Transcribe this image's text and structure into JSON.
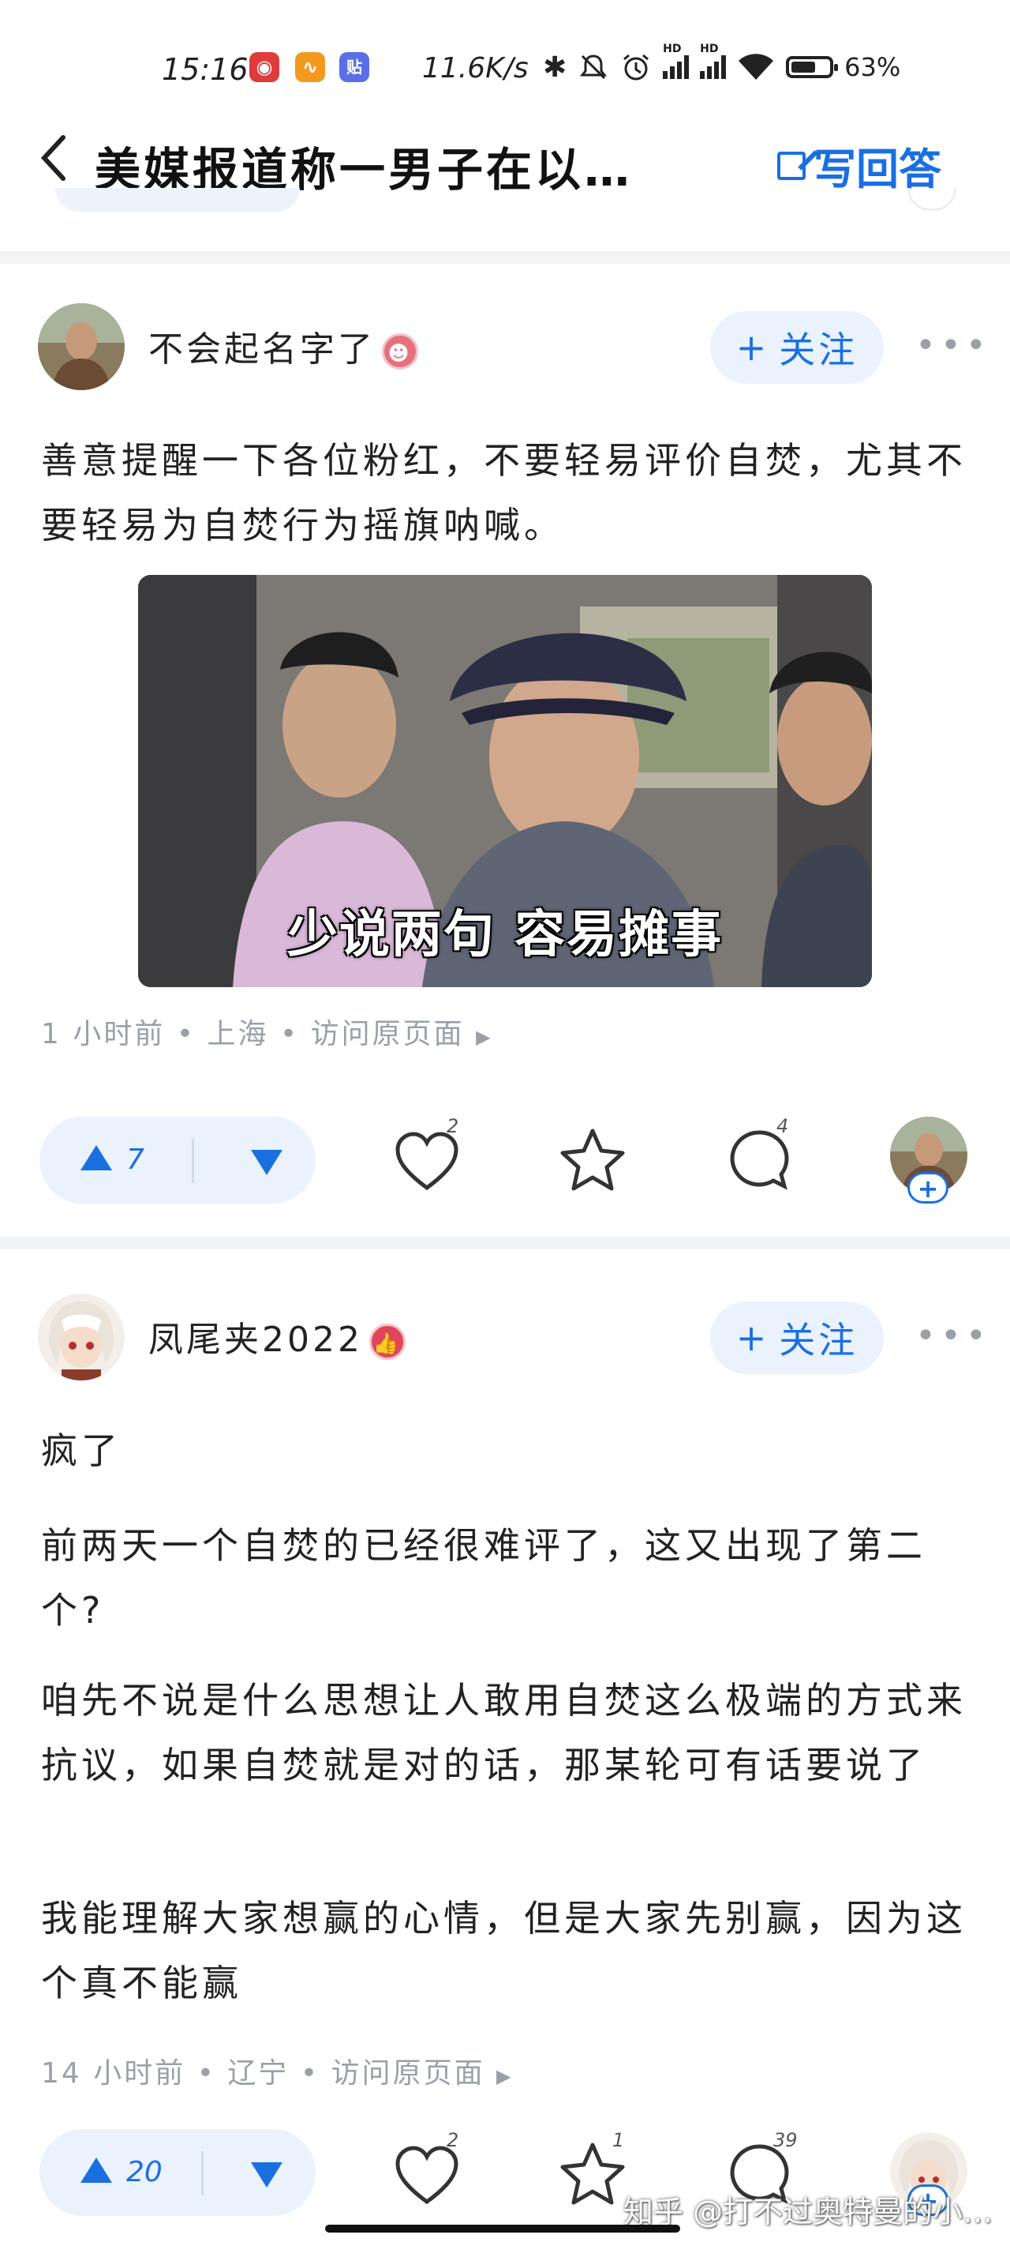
{
  "status_bar": {
    "time": "15:16",
    "app_icons": [
      "netease-icon",
      "orange-app-icon",
      "tieba-icon"
    ],
    "app_glyphs": [
      "◉",
      "∿",
      "贴"
    ],
    "speed": "11.6K/s",
    "icons": [
      "bluetooth-icon",
      "mute-icon",
      "alarm-icon",
      "hd-signal-icon",
      "hd-signal-icon",
      "wifi-icon",
      "battery-icon"
    ],
    "hd_label": "HD",
    "battery": "63%"
  },
  "nav": {
    "back_icon": "chevron-left-icon",
    "title": "美媒报道称一男子在以…",
    "write_label": "写回答"
  },
  "answers": [
    {
      "author": "不会起名字了",
      "badge": "☻",
      "follow_label": "关注",
      "follow_plus": "+",
      "more": "•••",
      "paragraphs": [
        "善意提醒一下各位粉红，不要轻易评价自焚，尤其不要轻易为自焚行为摇旗呐喊。"
      ],
      "image_caption": "少说两句 容易摊事",
      "meta": {
        "time": "1 小时前",
        "location": "上海",
        "link": "访问原页面"
      },
      "separator": "•",
      "upvotes": "7",
      "likes": "2",
      "favorites": "",
      "comments": "4",
      "mini_plus": "+"
    },
    {
      "author": "凤尾夹2022",
      "badge": "👍",
      "follow_label": "关注",
      "follow_plus": "+",
      "more": "•••",
      "paragraphs": [
        "疯了",
        "前两天一个自焚的已经很难评了，这又出现了第二个?",
        "咱先不说是什么思想让人敢用自焚这么极端的方式来抗议，如果自焚就是对的话，那某轮可有话要说了",
        "我能理解大家想赢的心情，但是大家先别赢，因为这个真不能赢"
      ],
      "meta": {
        "time": "14 小时前",
        "location": "辽宁",
        "link": "访问原页面"
      },
      "separator": "•",
      "upvotes": "20",
      "likes": "2",
      "favorites": "1",
      "comments": "39",
      "mini_plus": "+"
    }
  ],
  "watermark": "知乎 @打不过奥特曼的小…",
  "colors": {
    "accent": "#1a6fe0",
    "badge_red": "#e0455a",
    "meta_gray": "#9aa0a8",
    "divider": "#f2f3f5"
  }
}
